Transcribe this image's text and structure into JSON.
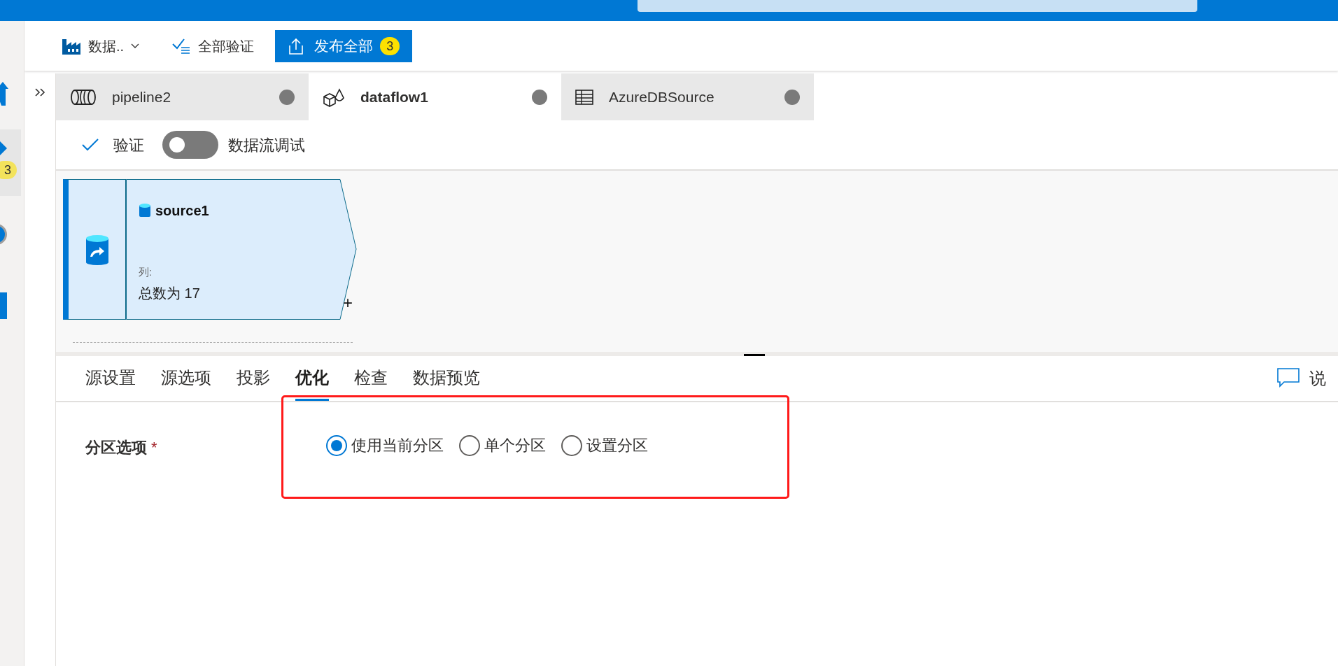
{
  "rail": {
    "badge": "3"
  },
  "toolbar": {
    "factory_label": "数据..",
    "validate_all": "全部验证",
    "publish": "发布全部",
    "publish_badge": "3"
  },
  "tabs": [
    {
      "label": "pipeline2",
      "kind": "pipeline",
      "selected": false
    },
    {
      "label": "dataflow1",
      "kind": "dataflow",
      "selected": true
    },
    {
      "label": "AzureDBSource",
      "kind": "table",
      "selected": false
    }
  ],
  "editor_toolbar": {
    "validate": "验证",
    "debug_label": "数据流调试",
    "debug_on": false
  },
  "node": {
    "name": "source1",
    "columns_label": "列:",
    "columns_value": "总数为 17",
    "add": "+"
  },
  "settings_tabs": [
    {
      "label": "源设置",
      "selected": false
    },
    {
      "label": "源选项",
      "selected": false
    },
    {
      "label": "投影",
      "selected": false
    },
    {
      "label": "优化",
      "selected": true
    },
    {
      "label": "检查",
      "selected": false
    },
    {
      "label": "数据预览",
      "selected": false
    }
  ],
  "comment_label": "说",
  "partition": {
    "label": "分区选项",
    "required": "*",
    "options": [
      {
        "label": "使用当前分区",
        "selected": true
      },
      {
        "label": "单个分区",
        "selected": false
      },
      {
        "label": "设置分区",
        "selected": false
      }
    ]
  }
}
